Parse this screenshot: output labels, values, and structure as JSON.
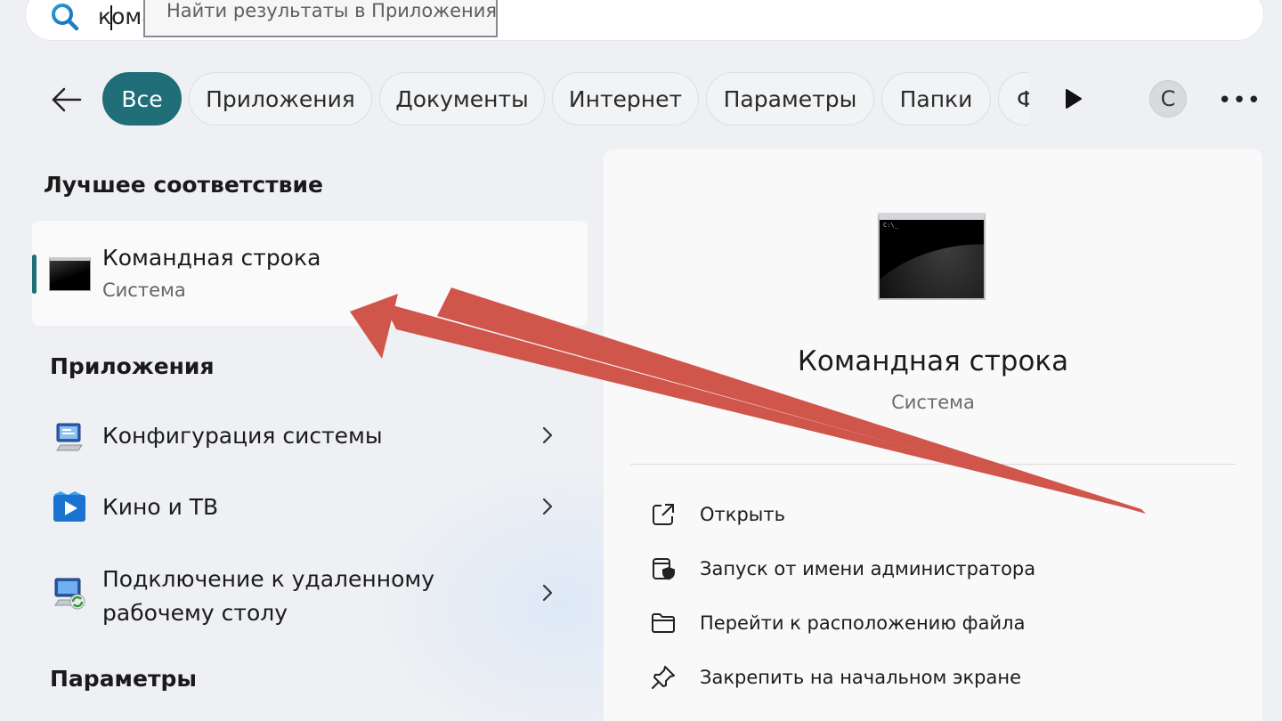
{
  "search": {
    "query": "команд",
    "tooltip": "Найти результаты в Приложения"
  },
  "filters": {
    "chips": [
      "Все",
      "Приложения",
      "Документы",
      "Интернет",
      "Параметры",
      "Папки",
      "Ф"
    ],
    "active_index": 0,
    "avatar_letter": "С",
    "more_label": "•••"
  },
  "best_match": {
    "heading": "Лучшее соответствие",
    "title": "Командная строка",
    "subtitle": "Система",
    "icon": "command-prompt-icon"
  },
  "apps": {
    "heading": "Приложения",
    "items": [
      {
        "title": "Конфигурация системы",
        "icon": "system-config-icon"
      },
      {
        "title": "Кино и ТВ",
        "icon": "movies-tv-icon"
      },
      {
        "title_line1": "Подключение к удаленному",
        "title_line2": "рабочему столу",
        "icon": "remote-desktop-icon"
      }
    ]
  },
  "settings": {
    "heading": "Параметры"
  },
  "detail": {
    "title": "Командная строка",
    "subtitle": "Система",
    "prompt_text": "C:\\_",
    "actions": [
      {
        "label": "Открыть",
        "icon": "open-external-icon"
      },
      {
        "label": "Запуск от имени администратора",
        "icon": "shield-admin-icon"
      },
      {
        "label": "Перейти к расположению файла",
        "icon": "folder-icon"
      },
      {
        "label": "Закрепить на начальном экране",
        "icon": "pin-icon"
      }
    ]
  },
  "colors": {
    "accent": "#1f6e78",
    "arrow": "#d0554b"
  }
}
